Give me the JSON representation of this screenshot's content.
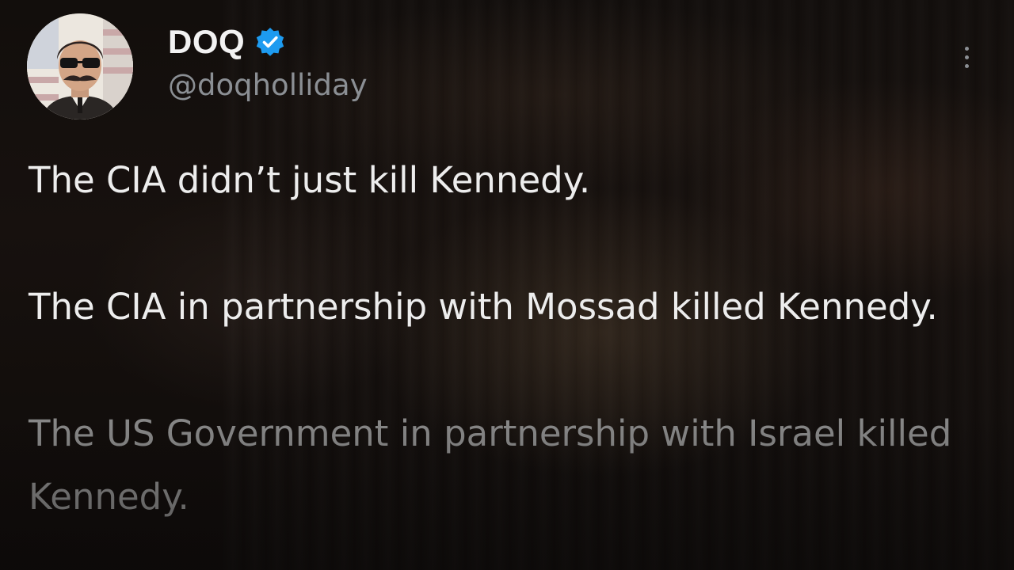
{
  "author": {
    "display_name": "DOQ",
    "handle": "@doqholliday",
    "verified": true,
    "verified_color": "#1d9bf0"
  },
  "post": {
    "paragraphs": [
      "The CIA didn’t just kill Kennedy.",
      "The CIA in partnership with Mossad killed Kennedy.",
      "The US Government in partnership with Israel killed Kennedy."
    ]
  },
  "icons": {
    "more": "more-vertical-icon",
    "verified": "verified-badge-icon"
  }
}
